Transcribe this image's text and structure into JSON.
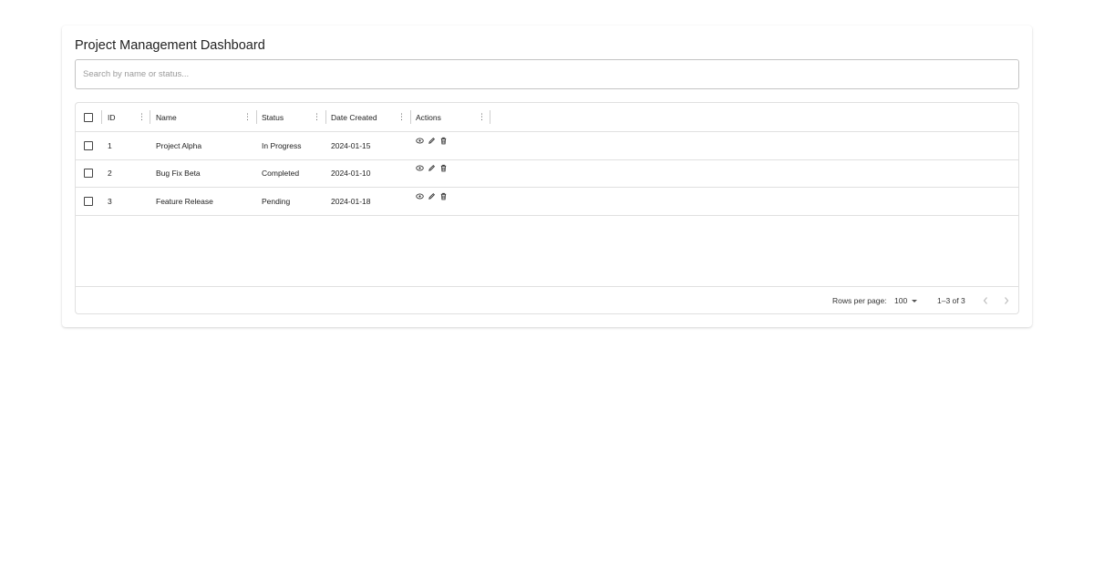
{
  "dashboard": {
    "title": "Project Management Dashboard"
  },
  "search": {
    "value": "",
    "placeholder": "Search by name or status..."
  },
  "table": {
    "columns": [
      {
        "label": "ID"
      },
      {
        "label": "Name"
      },
      {
        "label": "Status"
      },
      {
        "label": "Date Created"
      },
      {
        "label": "Actions"
      }
    ],
    "rows": [
      {
        "id": "1",
        "name": "Project Alpha",
        "status": "In Progress",
        "date": "2024-01-15"
      },
      {
        "id": "2",
        "name": "Bug Fix Beta",
        "status": "Completed",
        "date": "2024-01-10"
      },
      {
        "id": "3",
        "name": "Feature Release",
        "status": "Pending",
        "date": "2024-01-18"
      }
    ],
    "action_icons": [
      "eye-icon",
      "pencil-icon",
      "trash-icon"
    ]
  },
  "footer": {
    "rows_per_page_label": "Rows per page:",
    "rows_per_page_value": "100",
    "page_info": "1–3 of 3"
  },
  "colors": {
    "border": "#e0e0e0",
    "text": "#222222",
    "icon": "#333333"
  }
}
